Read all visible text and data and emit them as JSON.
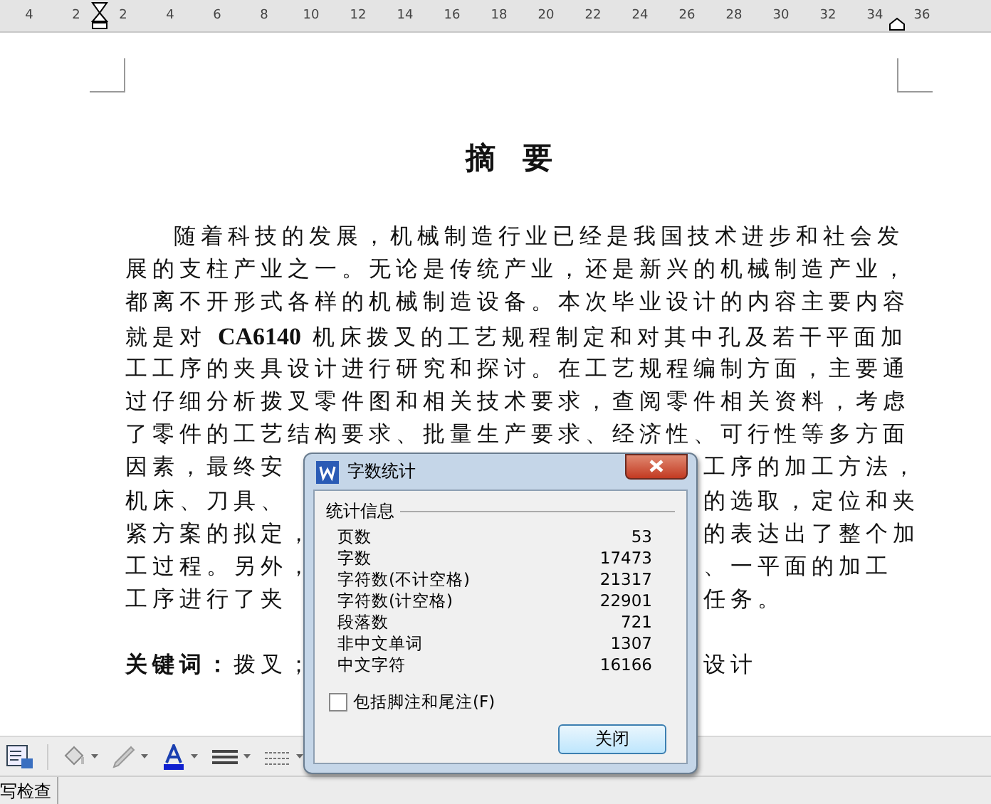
{
  "ruler": {
    "labels": [
      "4",
      "2",
      "2",
      "4",
      "6",
      "8",
      "10",
      "12",
      "14",
      "16",
      "18",
      "20",
      "22",
      "24",
      "26",
      "28",
      "30",
      "32",
      "34",
      "36"
    ]
  },
  "document": {
    "title": "摘 要",
    "lines": [
      {
        "left": "随着科技的发展，机械制造行业已经是我国技术进步和社会发",
        "indent": true
      },
      {
        "left": "展的支柱产业之一。无论是传统产业，还是新兴的机械制造产业，"
      },
      {
        "left": "都离不开形式各样的机械制造设备。本次毕业设计的内容主要内容"
      },
      {
        "left": "就是对 **CA6140** 机床拨叉的工艺规程制定和对其中孔及若干平面加"
      },
      {
        "left": "工工序的夹具设计进行研究和探讨。在工艺规程编制方面，主要通"
      },
      {
        "left": "过仔细分析拨叉零件图和相关技术要求，查阅零件相关资料，考虑"
      },
      {
        "left": "了零件的工艺结构要求、批量生产要求、经济性、可行性等多方面"
      },
      {
        "left": "因素，最终安",
        "right": "工序的加工方法，"
      },
      {
        "left": "机床、刀具、",
        "right": "的选取，定位和夹"
      },
      {
        "left": "紧方案的拟定，",
        "right": "的表达出了整个加"
      },
      {
        "left": "工过程。另外，",
        "right": "、一平面的加工"
      },
      {
        "left": "工序进行了夹",
        "right": "任务。"
      }
    ],
    "keywords": {
      "left": "**关键词：**拨叉；",
      "right": "设计"
    }
  },
  "dialog": {
    "title": "字数统计",
    "group": "统计信息",
    "stats": [
      {
        "label": "页数",
        "value": "53"
      },
      {
        "label": "字数",
        "value": "17473"
      },
      {
        "label": "字符数(不计空格)",
        "value": "21317"
      },
      {
        "label": "字符数(计空格)",
        "value": "22901"
      },
      {
        "label": "段落数",
        "value": "721"
      },
      {
        "label": "非中文单词",
        "value": "1307"
      },
      {
        "label": "中文字符",
        "value": "16166"
      }
    ],
    "checkbox": {
      "label": "包括脚注和尾注(F)",
      "checked": false
    },
    "button": "关闭"
  },
  "status_bar": {
    "text": "写检查"
  }
}
